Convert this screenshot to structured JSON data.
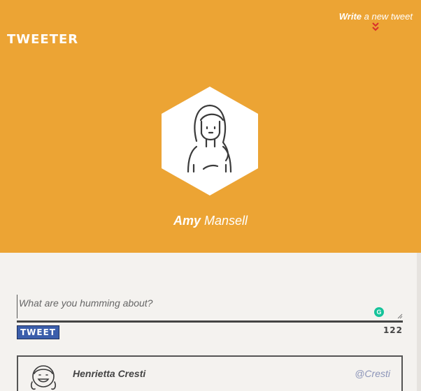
{
  "header": {
    "logo": "TWEETER",
    "write_link": {
      "strong": "Write",
      "rest": "a new tweet"
    },
    "profile": {
      "first_name": "Amy",
      "last_name": "Mansell"
    }
  },
  "composer": {
    "placeholder": "What are you humming about?",
    "value": "",
    "tweet_button": "TWEET",
    "char_count": "122"
  },
  "feed": [
    {
      "name": "Henrietta Cresti",
      "handle": "@Cresti"
    }
  ],
  "colors": {
    "header_bg": "#eca434",
    "body_bg": "#f4f2ef",
    "tweet_button": "#3b5eab",
    "chevron": "#d9302b",
    "handle": "#8b94b8"
  }
}
